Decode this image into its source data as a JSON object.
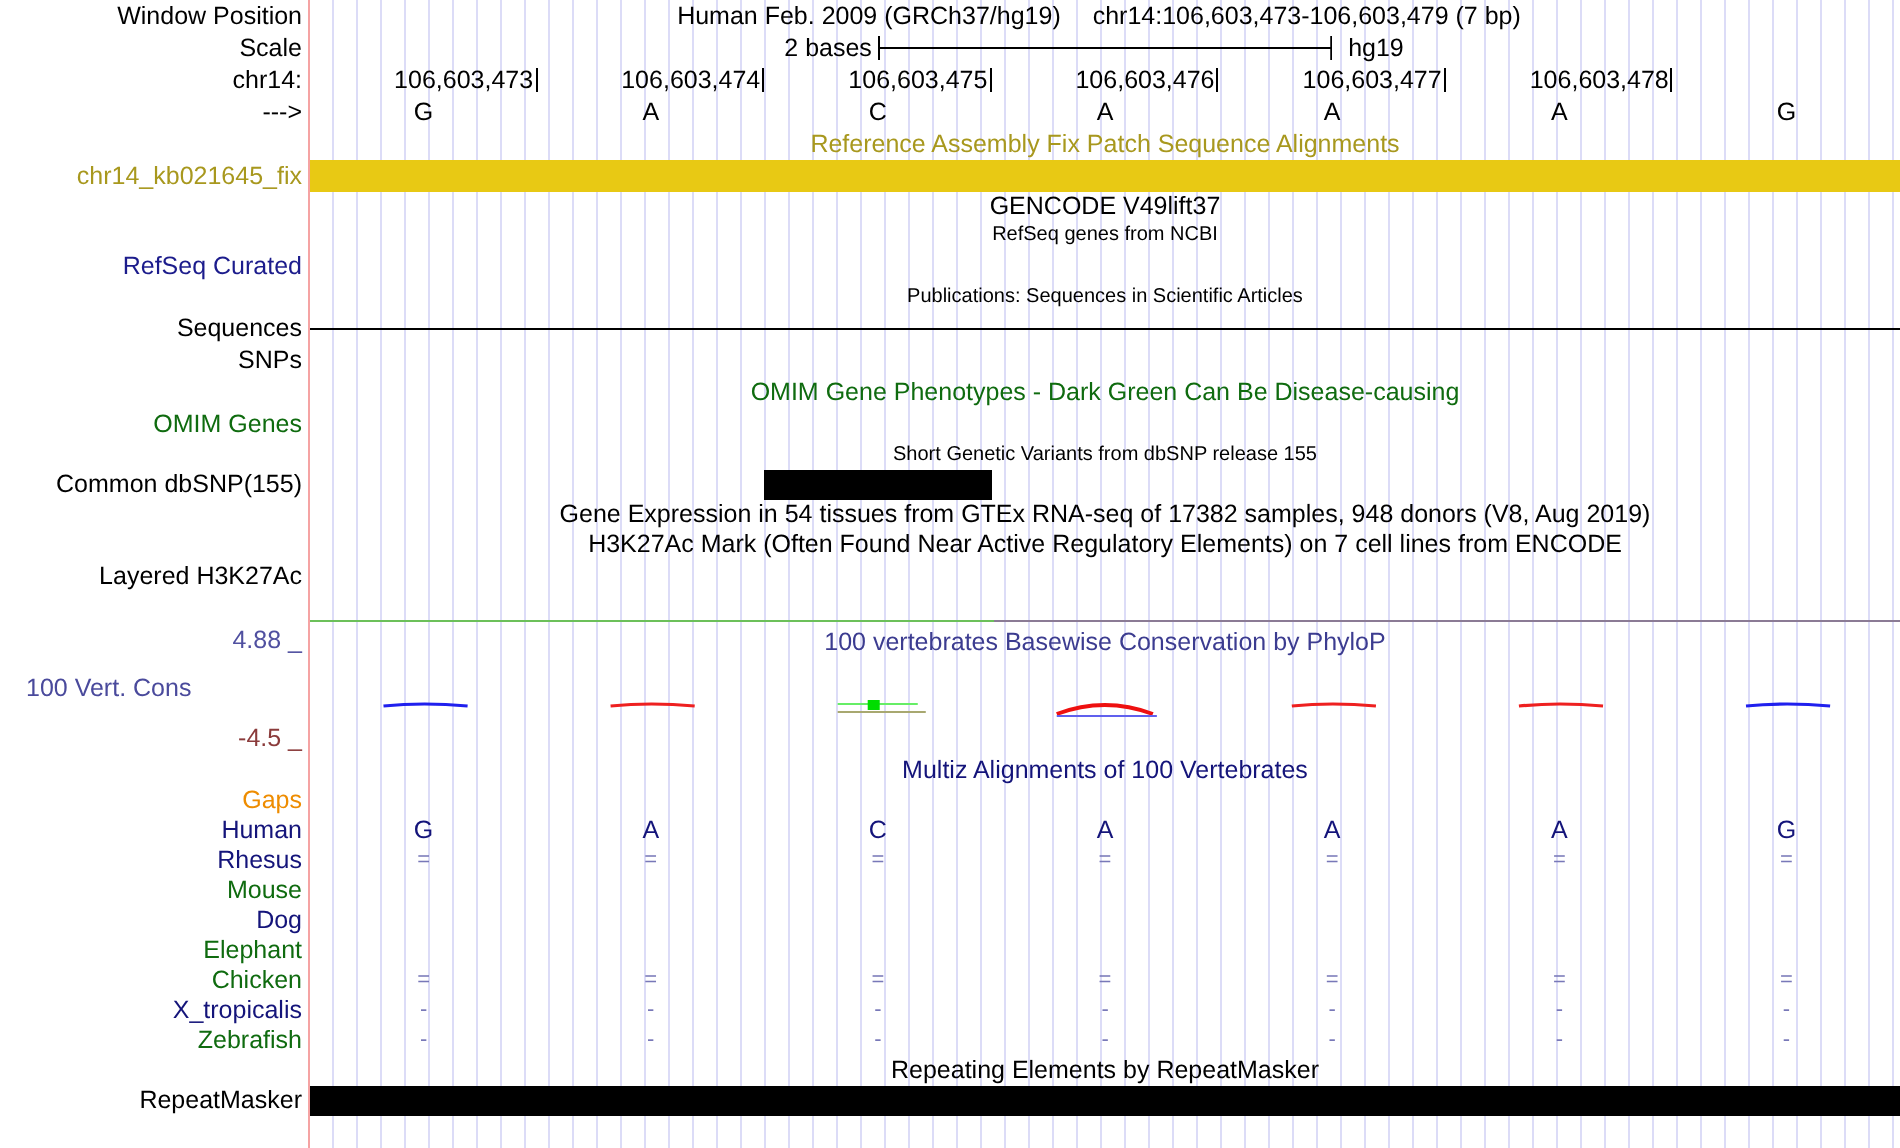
{
  "window_position": {
    "label": "Window Position",
    "assembly": "Human Feb. 2009 (GRCh37/hg19)",
    "range": "chr14:106,603,473-106,603,479 (7 bp)"
  },
  "scale": {
    "label": "Scale",
    "length": "2 bases",
    "assembly": "hg19"
  },
  "ruler": {
    "label": "chr14:",
    "ticks": [
      "106,603,473",
      "106,603,474",
      "106,603,475",
      "106,603,476",
      "106,603,477",
      "106,603,478"
    ]
  },
  "strand": {
    "label": "--->",
    "bases": [
      "G",
      "A",
      "C",
      "A",
      "A",
      "A",
      "G"
    ]
  },
  "rows": [
    {
      "kind": "title",
      "text": "Reference Assembly Fix Patch Sequence Alignments",
      "small": false,
      "color": "#a8981e"
    },
    {
      "kind": "track",
      "label": "chr14_kb021645_fix",
      "color": "#a8981e",
      "bar": {
        "color": "#e8c914",
        "covered": [
          true,
          true,
          true,
          true,
          true,
          true,
          true
        ]
      }
    },
    {
      "kind": "title",
      "text": "GENCODE V49lift37",
      "small": false,
      "color": "#000000"
    },
    {
      "kind": "title",
      "text": "RefSeq genes from NCBI",
      "small": true,
      "color": "#000000"
    },
    {
      "kind": "track",
      "label": "RefSeq Curated",
      "color": "#1c1c8c"
    },
    {
      "kind": "title",
      "text": "Publications: Sequences in Scientific Articles",
      "small": true,
      "color": "#000000"
    },
    {
      "kind": "track",
      "label": "Sequences",
      "color": "#000000",
      "line": true
    },
    {
      "kind": "track",
      "label": "SNPs",
      "color": "#000000"
    },
    {
      "kind": "title",
      "text": "OMIM Gene Phenotypes - Dark Green Can Be Disease-causing",
      "small": false,
      "color": "#0f6b0f"
    },
    {
      "kind": "track",
      "label": "OMIM Genes",
      "color": "#0f6b0f"
    },
    {
      "kind": "title",
      "text": "Short Genetic Variants from dbSNP release 155",
      "small": true,
      "color": "#000000"
    },
    {
      "kind": "track",
      "label": "Common dbSNP(155)",
      "color": "#000000",
      "bar": {
        "color": "#000000",
        "covered": [
          false,
          false,
          true,
          false,
          false,
          false,
          false
        ]
      }
    },
    {
      "kind": "title",
      "text": "Gene Expression in 54 tissues from GTEx RNA-seq of 17382 samples, 948 donors (V8, Aug 2019)",
      "small": false,
      "color": "#000000"
    },
    {
      "kind": "title",
      "text": "H3K27Ac Mark (Often Found Near Active Regulatory Elements) on 7 cell lines from ENCODE",
      "small": false,
      "color": "#000000"
    },
    {
      "kind": "track",
      "label": "Layered H3K27Ac",
      "color": "#000000"
    },
    {
      "kind": "conservation",
      "max_label": "4.88 _",
      "track_label": "100 Vert. Cons",
      "min_label": "-4.5 _",
      "title": "100 vertebrates Basewise Conservation by PhyloP"
    },
    {
      "kind": "title",
      "text": "Multiz Alignments of 100 Vertebrates",
      "small": false,
      "color": "#14147a"
    },
    {
      "kind": "track",
      "label": "Gaps",
      "color": "#ee8c00"
    },
    {
      "kind": "alignment",
      "label": "Human",
      "color": "#14147a",
      "bases": [
        "G",
        "A",
        "C",
        "A",
        "A",
        "A",
        "G"
      ]
    },
    {
      "kind": "alignment",
      "label": "Rhesus",
      "color": "#14147a",
      "bases": [
        "=",
        "=",
        "=",
        "=",
        "=",
        "=",
        "="
      ]
    },
    {
      "kind": "alignment",
      "label": "Mouse",
      "color": "#0f6b0f"
    },
    {
      "kind": "alignment",
      "label": "Dog",
      "color": "#14147a"
    },
    {
      "kind": "alignment",
      "label": "Elephant",
      "color": "#0f6b0f"
    },
    {
      "kind": "alignment",
      "label": "Chicken",
      "color": "#0f6b0f",
      "bases": [
        "=",
        "=",
        "=",
        "=",
        "=",
        "=",
        "="
      ]
    },
    {
      "kind": "alignment",
      "label": "X_tropicalis",
      "color": "#14147a",
      "bases": [
        "-",
        "-",
        "-",
        "-",
        "-",
        "-",
        "-"
      ]
    },
    {
      "kind": "alignment",
      "label": "Zebrafish",
      "color": "#0f6b0f",
      "bases": [
        "-",
        "-",
        "-",
        "-",
        "-",
        "-",
        "-"
      ]
    },
    {
      "kind": "title",
      "text": "Repeating Elements by RepeatMasker",
      "small": false,
      "color": "#000000"
    },
    {
      "kind": "track",
      "label": "RepeatMasker",
      "color": "#000000",
      "bar": {
        "color": "#000000",
        "covered": [
          true,
          true,
          true,
          true,
          true,
          true,
          true
        ]
      }
    }
  ]
}
